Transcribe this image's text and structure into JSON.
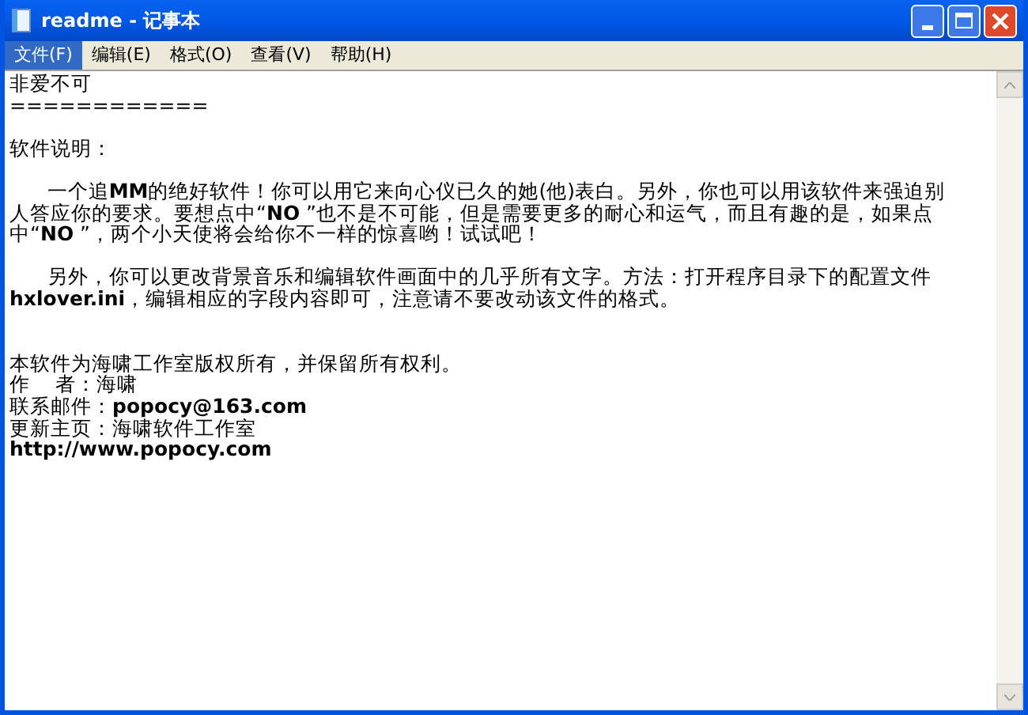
{
  "window": {
    "title": "readme - 记事本"
  },
  "menu": [
    {
      "label": "文件(F)",
      "selected": true
    },
    {
      "label": "编辑(E)",
      "selected": false
    },
    {
      "label": "格式(O)",
      "selected": false
    },
    {
      "label": "查看(V)",
      "selected": false
    },
    {
      "label": "帮助(H)",
      "selected": false
    }
  ],
  "document": {
    "blocks": [
      {
        "kind": "first",
        "lines": [
          "非爱不可",
          "============"
        ]
      },
      {
        "kind": "paragraph",
        "lines": [
          "软件说明："
        ]
      },
      {
        "kind": "paragraph",
        "lines": [
          "      一个追**MM**的绝好软件！你可以用它来向心仪已久的她(他)表白。另外，你也可以用该软件来强迫别",
          "人答应你的要求。要想点中“**NO** ”也不是不可能，但是需要更多的耐心和运气，而且有趣的是，如果点",
          "中“**NO** ”，两个小天使将会给你不一样的惊喜哟！试试吧！"
        ]
      },
      {
        "kind": "paragraph",
        "lines": [
          "      另外，你可以更改背景音乐和编辑软件画面中的几乎所有文字。方法：打开程序目录下的配置文件",
          "**hxlover.ini**，编辑相应的字段内容即可，注意请不要改动该文件的格式。"
        ]
      },
      {
        "kind": "section",
        "lines": [
          "本软件为海啸工作室版权所有，并保留所有权利。",
          "作    者：海啸",
          "联系邮件：**popocy@163.com**",
          "更新主页：海啸软件工作室",
          "**http://www.popocy.com**"
        ]
      }
    ]
  }
}
